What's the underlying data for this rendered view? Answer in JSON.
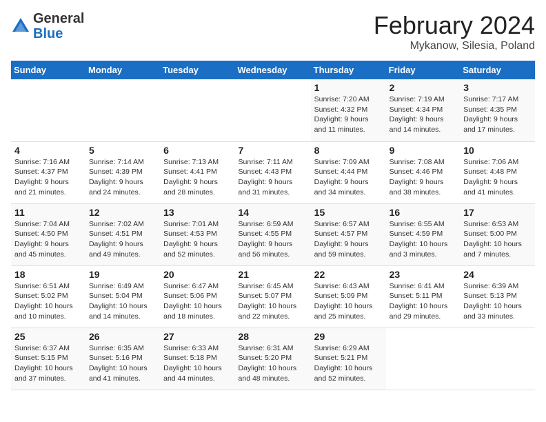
{
  "logo": {
    "general": "General",
    "blue": "Blue"
  },
  "header": {
    "month": "February 2024",
    "location": "Mykanow, Silesia, Poland"
  },
  "weekdays": [
    "Sunday",
    "Monday",
    "Tuesday",
    "Wednesday",
    "Thursday",
    "Friday",
    "Saturday"
  ],
  "weeks": [
    [
      {
        "day": "",
        "info": ""
      },
      {
        "day": "",
        "info": ""
      },
      {
        "day": "",
        "info": ""
      },
      {
        "day": "",
        "info": ""
      },
      {
        "day": "1",
        "info": "Sunrise: 7:20 AM\nSunset: 4:32 PM\nDaylight: 9 hours\nand 11 minutes."
      },
      {
        "day": "2",
        "info": "Sunrise: 7:19 AM\nSunset: 4:34 PM\nDaylight: 9 hours\nand 14 minutes."
      },
      {
        "day": "3",
        "info": "Sunrise: 7:17 AM\nSunset: 4:35 PM\nDaylight: 9 hours\nand 17 minutes."
      }
    ],
    [
      {
        "day": "4",
        "info": "Sunrise: 7:16 AM\nSunset: 4:37 PM\nDaylight: 9 hours\nand 21 minutes."
      },
      {
        "day": "5",
        "info": "Sunrise: 7:14 AM\nSunset: 4:39 PM\nDaylight: 9 hours\nand 24 minutes."
      },
      {
        "day": "6",
        "info": "Sunrise: 7:13 AM\nSunset: 4:41 PM\nDaylight: 9 hours\nand 28 minutes."
      },
      {
        "day": "7",
        "info": "Sunrise: 7:11 AM\nSunset: 4:43 PM\nDaylight: 9 hours\nand 31 minutes."
      },
      {
        "day": "8",
        "info": "Sunrise: 7:09 AM\nSunset: 4:44 PM\nDaylight: 9 hours\nand 34 minutes."
      },
      {
        "day": "9",
        "info": "Sunrise: 7:08 AM\nSunset: 4:46 PM\nDaylight: 9 hours\nand 38 minutes."
      },
      {
        "day": "10",
        "info": "Sunrise: 7:06 AM\nSunset: 4:48 PM\nDaylight: 9 hours\nand 41 minutes."
      }
    ],
    [
      {
        "day": "11",
        "info": "Sunrise: 7:04 AM\nSunset: 4:50 PM\nDaylight: 9 hours\nand 45 minutes."
      },
      {
        "day": "12",
        "info": "Sunrise: 7:02 AM\nSunset: 4:51 PM\nDaylight: 9 hours\nand 49 minutes."
      },
      {
        "day": "13",
        "info": "Sunrise: 7:01 AM\nSunset: 4:53 PM\nDaylight: 9 hours\nand 52 minutes."
      },
      {
        "day": "14",
        "info": "Sunrise: 6:59 AM\nSunset: 4:55 PM\nDaylight: 9 hours\nand 56 minutes."
      },
      {
        "day": "15",
        "info": "Sunrise: 6:57 AM\nSunset: 4:57 PM\nDaylight: 9 hours\nand 59 minutes."
      },
      {
        "day": "16",
        "info": "Sunrise: 6:55 AM\nSunset: 4:59 PM\nDaylight: 10 hours\nand 3 minutes."
      },
      {
        "day": "17",
        "info": "Sunrise: 6:53 AM\nSunset: 5:00 PM\nDaylight: 10 hours\nand 7 minutes."
      }
    ],
    [
      {
        "day": "18",
        "info": "Sunrise: 6:51 AM\nSunset: 5:02 PM\nDaylight: 10 hours\nand 10 minutes."
      },
      {
        "day": "19",
        "info": "Sunrise: 6:49 AM\nSunset: 5:04 PM\nDaylight: 10 hours\nand 14 minutes."
      },
      {
        "day": "20",
        "info": "Sunrise: 6:47 AM\nSunset: 5:06 PM\nDaylight: 10 hours\nand 18 minutes."
      },
      {
        "day": "21",
        "info": "Sunrise: 6:45 AM\nSunset: 5:07 PM\nDaylight: 10 hours\nand 22 minutes."
      },
      {
        "day": "22",
        "info": "Sunrise: 6:43 AM\nSunset: 5:09 PM\nDaylight: 10 hours\nand 25 minutes."
      },
      {
        "day": "23",
        "info": "Sunrise: 6:41 AM\nSunset: 5:11 PM\nDaylight: 10 hours\nand 29 minutes."
      },
      {
        "day": "24",
        "info": "Sunrise: 6:39 AM\nSunset: 5:13 PM\nDaylight: 10 hours\nand 33 minutes."
      }
    ],
    [
      {
        "day": "25",
        "info": "Sunrise: 6:37 AM\nSunset: 5:15 PM\nDaylight: 10 hours\nand 37 minutes."
      },
      {
        "day": "26",
        "info": "Sunrise: 6:35 AM\nSunset: 5:16 PM\nDaylight: 10 hours\nand 41 minutes."
      },
      {
        "day": "27",
        "info": "Sunrise: 6:33 AM\nSunset: 5:18 PM\nDaylight: 10 hours\nand 44 minutes."
      },
      {
        "day": "28",
        "info": "Sunrise: 6:31 AM\nSunset: 5:20 PM\nDaylight: 10 hours\nand 48 minutes."
      },
      {
        "day": "29",
        "info": "Sunrise: 6:29 AM\nSunset: 5:21 PM\nDaylight: 10 hours\nand 52 minutes."
      },
      {
        "day": "",
        "info": ""
      },
      {
        "day": "",
        "info": ""
      }
    ]
  ]
}
